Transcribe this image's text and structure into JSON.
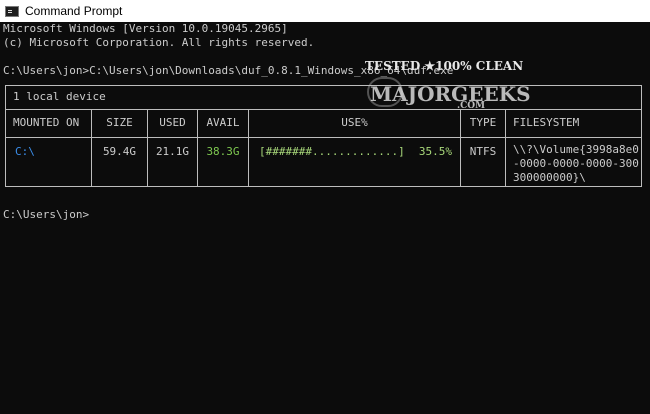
{
  "window": {
    "title": "Command Prompt"
  },
  "console": {
    "lines": [
      "Microsoft Windows [Version 10.0.19045.2965]",
      "(c) Microsoft Corporation. All rights reserved.",
      "C:\\Users\\jon>C:\\Users\\jon\\Downloads\\duf_0.8.1_Windows_x86_64\\duf.exe",
      "C:\\Users\\jon>"
    ]
  },
  "duf": {
    "header": "1 local device",
    "columns": [
      "MOUNTED ON",
      "SIZE",
      "USED",
      "AVAIL",
      "USE%",
      "TYPE",
      "FILESYSTEM"
    ],
    "row": {
      "mounted_on": "C:\\",
      "size": "59.4G",
      "used": "21.1G",
      "avail": "38.3G",
      "use_bar": "[#######.............]",
      "use_pct": "35.5%",
      "type": "NTFS",
      "filesystem_lines": [
        "\\\\?\\Volume{3998a8e0",
        "-0000-0000-0000-300",
        "300000000}\\"
      ]
    },
    "colors": {
      "mount": "#3b8eea",
      "avail": "#7ec850",
      "bar": "#a8d87a",
      "text": "#cccccc",
      "border": "#bdbdbd"
    }
  },
  "watermark": {
    "line1": "TESTED ★100% CLEAN",
    "line2": "MAJORGEEKS",
    "line3": ".COM"
  }
}
